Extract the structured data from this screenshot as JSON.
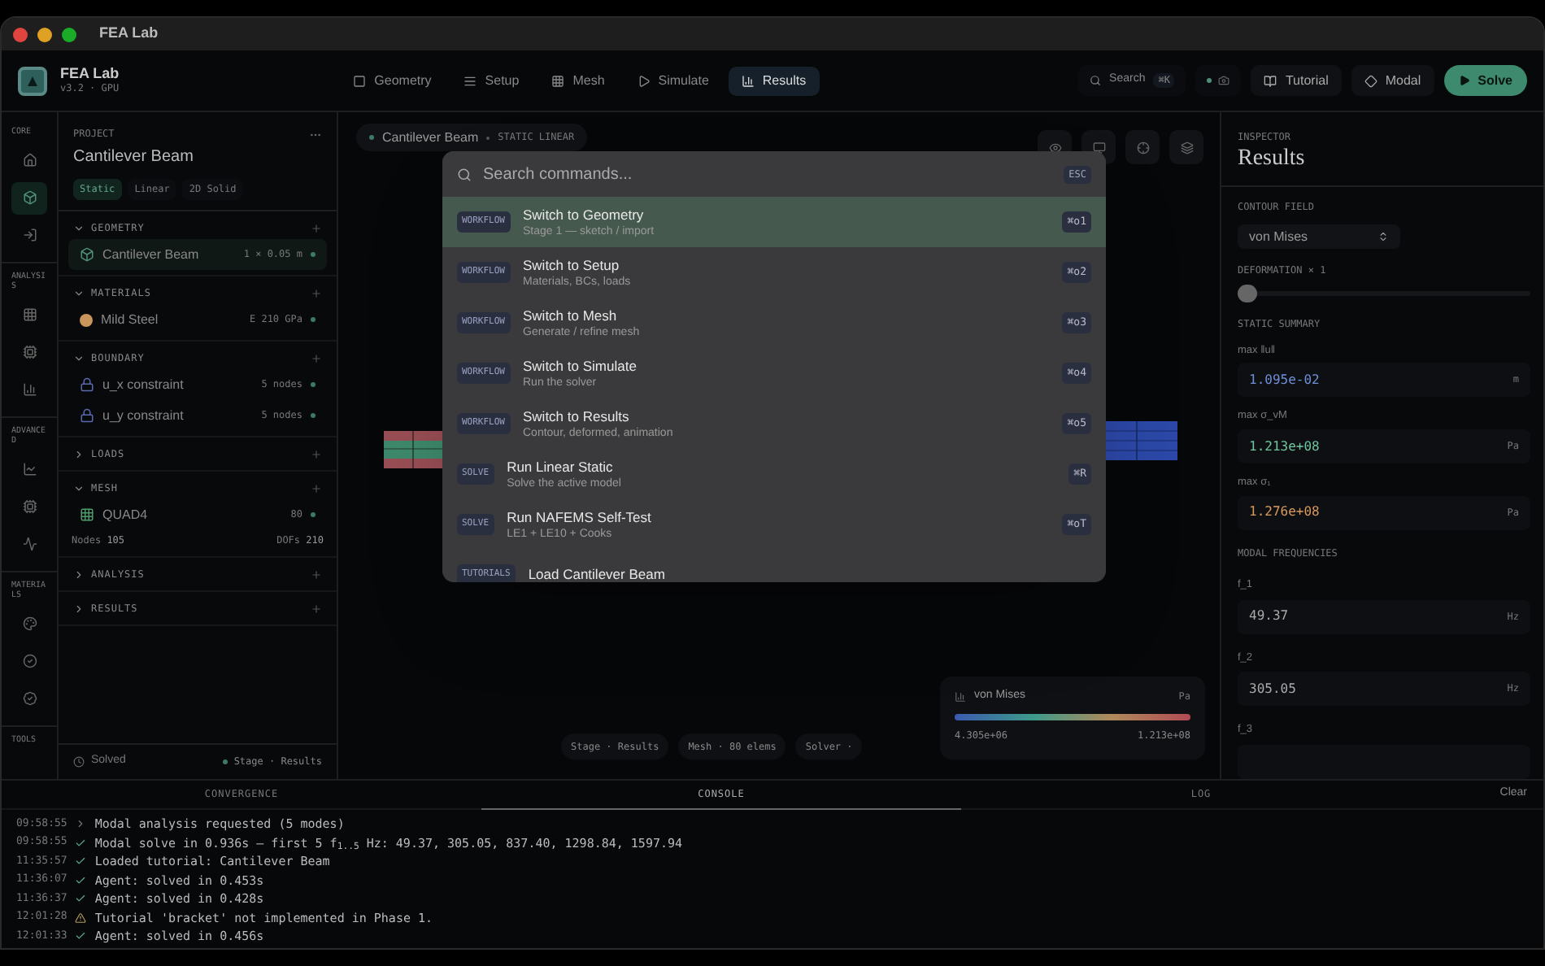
{
  "window": {
    "title": "FEA Lab"
  },
  "app": {
    "name": "FEA Lab",
    "version": "v3.2 · GPU"
  },
  "nav": [
    {
      "label": "Geometry",
      "kind": "geometry",
      "selected": false
    },
    {
      "label": "Setup",
      "kind": "setup",
      "selected": false
    },
    {
      "label": "Mesh",
      "kind": "mesh",
      "selected": false
    },
    {
      "label": "Simulate",
      "kind": "simulate",
      "selected": false
    },
    {
      "label": "Results",
      "kind": "results",
      "selected": true
    }
  ],
  "toolbar": {
    "search": {
      "label": "Search",
      "shortcut": "⌘K"
    },
    "buttons": [
      {
        "label": "Tutorial",
        "kind": "book"
      },
      {
        "label": "Modal",
        "kind": "modal"
      }
    ],
    "solve": "Solve"
  },
  "rail": [
    {
      "label": "CORE",
      "items": [
        {
          "kind": "home",
          "selected": false
        },
        {
          "kind": "cube",
          "selected": true
        },
        {
          "kind": "import",
          "selected": false
        }
      ]
    },
    {
      "label": "ANALYSIS",
      "items": [
        {
          "kind": "grid",
          "selected": false
        },
        {
          "kind": "chip",
          "selected": false
        },
        {
          "kind": "bars",
          "selected": false
        }
      ]
    },
    {
      "label": "ADVANCED",
      "items": [
        {
          "kind": "chart",
          "selected": false
        },
        {
          "kind": "chip",
          "selected": false
        },
        {
          "kind": "wave",
          "selected": false
        }
      ]
    },
    {
      "label": "MATERIALS",
      "items": [
        {
          "kind": "palette",
          "selected": false
        },
        {
          "kind": "check",
          "selected": false
        },
        {
          "kind": "badge",
          "selected": false
        }
      ]
    },
    {
      "label": "TOOLS"
    }
  ],
  "project": {
    "label": "PROJECT",
    "name": "Cantilever Beam",
    "tags": [
      {
        "label": "Static",
        "selected": true
      },
      {
        "label": "Linear",
        "selected": false
      },
      {
        "label": "2D Solid",
        "selected": false
      }
    ],
    "sections": [
      {
        "title": "GEOMETRY",
        "expanded": true,
        "items": [
          {
            "kind": "geometry",
            "name": "Cantilever Beam",
            "meta": "1 × 0.05 m",
            "selected": true
          }
        ]
      },
      {
        "title": "MATERIALS",
        "expanded": true,
        "items": [
          {
            "kind": "material",
            "name": "Mild Steel",
            "meta": "E 210 GPa",
            "color": "#c8955a",
            "selected": false
          }
        ]
      },
      {
        "title": "BOUNDARY",
        "expanded": true,
        "items": [
          {
            "kind": "constraint",
            "name": "u_x constraint",
            "meta": "5 nodes",
            "selected": false
          },
          {
            "kind": "constraint",
            "name": "u_y constraint",
            "meta": "5 nodes",
            "selected": false
          }
        ]
      },
      {
        "title": "LOADS",
        "expanded": false
      },
      {
        "title": "MESH",
        "expanded": true,
        "items": [
          {
            "kind": "element",
            "name": "QUAD4",
            "meta": "80",
            "selected": false
          }
        ],
        "stats": [
          {
            "label": "Nodes",
            "value": "105"
          },
          {
            "label": "DOFs",
            "value": "210"
          }
        ]
      },
      {
        "title": "ANALYSIS",
        "expanded": false
      },
      {
        "title": "RESULTS",
        "expanded": false
      }
    ],
    "footer": {
      "status": "Solved",
      "stage": "Stage · Results"
    }
  },
  "canvas": {
    "title": "Cantilever Beam",
    "subtitle": "STATIC LINEAR",
    "pills": [
      "Stage · Results",
      "Mesh · 80 elems",
      "Solver ·"
    ],
    "legend": {
      "title": "von Mises",
      "unit": "Pa",
      "min": "4.305e+06",
      "max": "1.213e+08"
    }
  },
  "palette": {
    "placeholder": "Search commands...",
    "esc": "ESC",
    "commands": [
      {
        "tag": "WORKFLOW",
        "title": "Switch to Geometry",
        "subtitle": "Stage 1 — sketch / import",
        "shortcut": "⌘o1",
        "selected": true
      },
      {
        "tag": "WORKFLOW",
        "title": "Switch to Setup",
        "subtitle": "Materials, BCs, loads",
        "shortcut": "⌘o2",
        "selected": false
      },
      {
        "tag": "WORKFLOW",
        "title": "Switch to Mesh",
        "subtitle": "Generate / refine mesh",
        "shortcut": "⌘o3",
        "selected": false
      },
      {
        "tag": "WORKFLOW",
        "title": "Switch to Simulate",
        "subtitle": "Run the solver",
        "shortcut": "⌘o4",
        "selected": false
      },
      {
        "tag": "WORKFLOW",
        "title": "Switch to Results",
        "subtitle": "Contour, deformed, animation",
        "shortcut": "⌘o5",
        "selected": false
      },
      {
        "tag": "SOLVE",
        "title": "Run Linear Static",
        "subtitle": "Solve the active model",
        "shortcut": "⌘R",
        "selected": false
      },
      {
        "tag": "SOLVE",
        "title": "Run NAFEMS Self-Test",
        "subtitle": "LE1 + LE10 + Cooks",
        "shortcut": "⌘oT",
        "selected": false
      },
      {
        "tag": "TUTORIALS",
        "title": "Load Cantilever Beam",
        "selected": false
      }
    ]
  },
  "inspector": {
    "label": "INSPECTOR",
    "title": "Results",
    "contour_label": "CONTOUR FIELD",
    "contour": "von Mises",
    "deformation_label": "DEFORMATION × 1",
    "deformation": {
      "level": 0
    },
    "summary_label": "STATIC SUMMARY",
    "summary": [
      {
        "label": "max ‖u‖",
        "value": "1.095e-02",
        "unit": "m",
        "color": "#6f8fd8"
      },
      {
        "label": "max σ_vM",
        "value": "1.213e+08",
        "unit": "Pa",
        "color": "#6fc79f"
      },
      {
        "label": "max σ₁",
        "value": "1.276e+08",
        "unit": "Pa",
        "color": "#d99a5e"
      }
    ],
    "modal_label": "MODAL FREQUENCIES",
    "modes": [
      {
        "label": "f_1",
        "value": "49.37",
        "unit": "Hz"
      },
      {
        "label": "f_2",
        "value": "305.05",
        "unit": "Hz"
      },
      {
        "label": "f_3"
      }
    ]
  },
  "console": {
    "tabs": [
      {
        "label": "CONVERGENCE",
        "selected": false
      },
      {
        "label": "CONSOLE",
        "selected": true
      },
      {
        "label": "LOG",
        "selected": false
      }
    ],
    "clear": "Clear",
    "lines": [
      {
        "time": "09:58:55",
        "kind": "info",
        "text": "Modal analysis requested (5 modes)"
      },
      {
        "time": "09:58:55",
        "kind": "success",
        "text": "Modal solve in 0.936s — first 5 f$_{1..5}$ Hz: 49.37, 305.05, 837.40, 1298.84, 1597.94"
      },
      {
        "time": "11:35:57",
        "kind": "success",
        "text": "Loaded tutorial: Cantilever Beam"
      },
      {
        "time": "11:36:07",
        "kind": "success",
        "text": "Agent: solved in 0.453s"
      },
      {
        "time": "11:36:37",
        "kind": "success",
        "text": "Agent: solved in 0.428s"
      },
      {
        "time": "12:01:28",
        "kind": "warning",
        "text": "Tutorial 'bracket' not implemented in Phase 1."
      },
      {
        "time": "12:01:33",
        "kind": "success",
        "text": "Agent: solved in 0.456s"
      }
    ]
  }
}
